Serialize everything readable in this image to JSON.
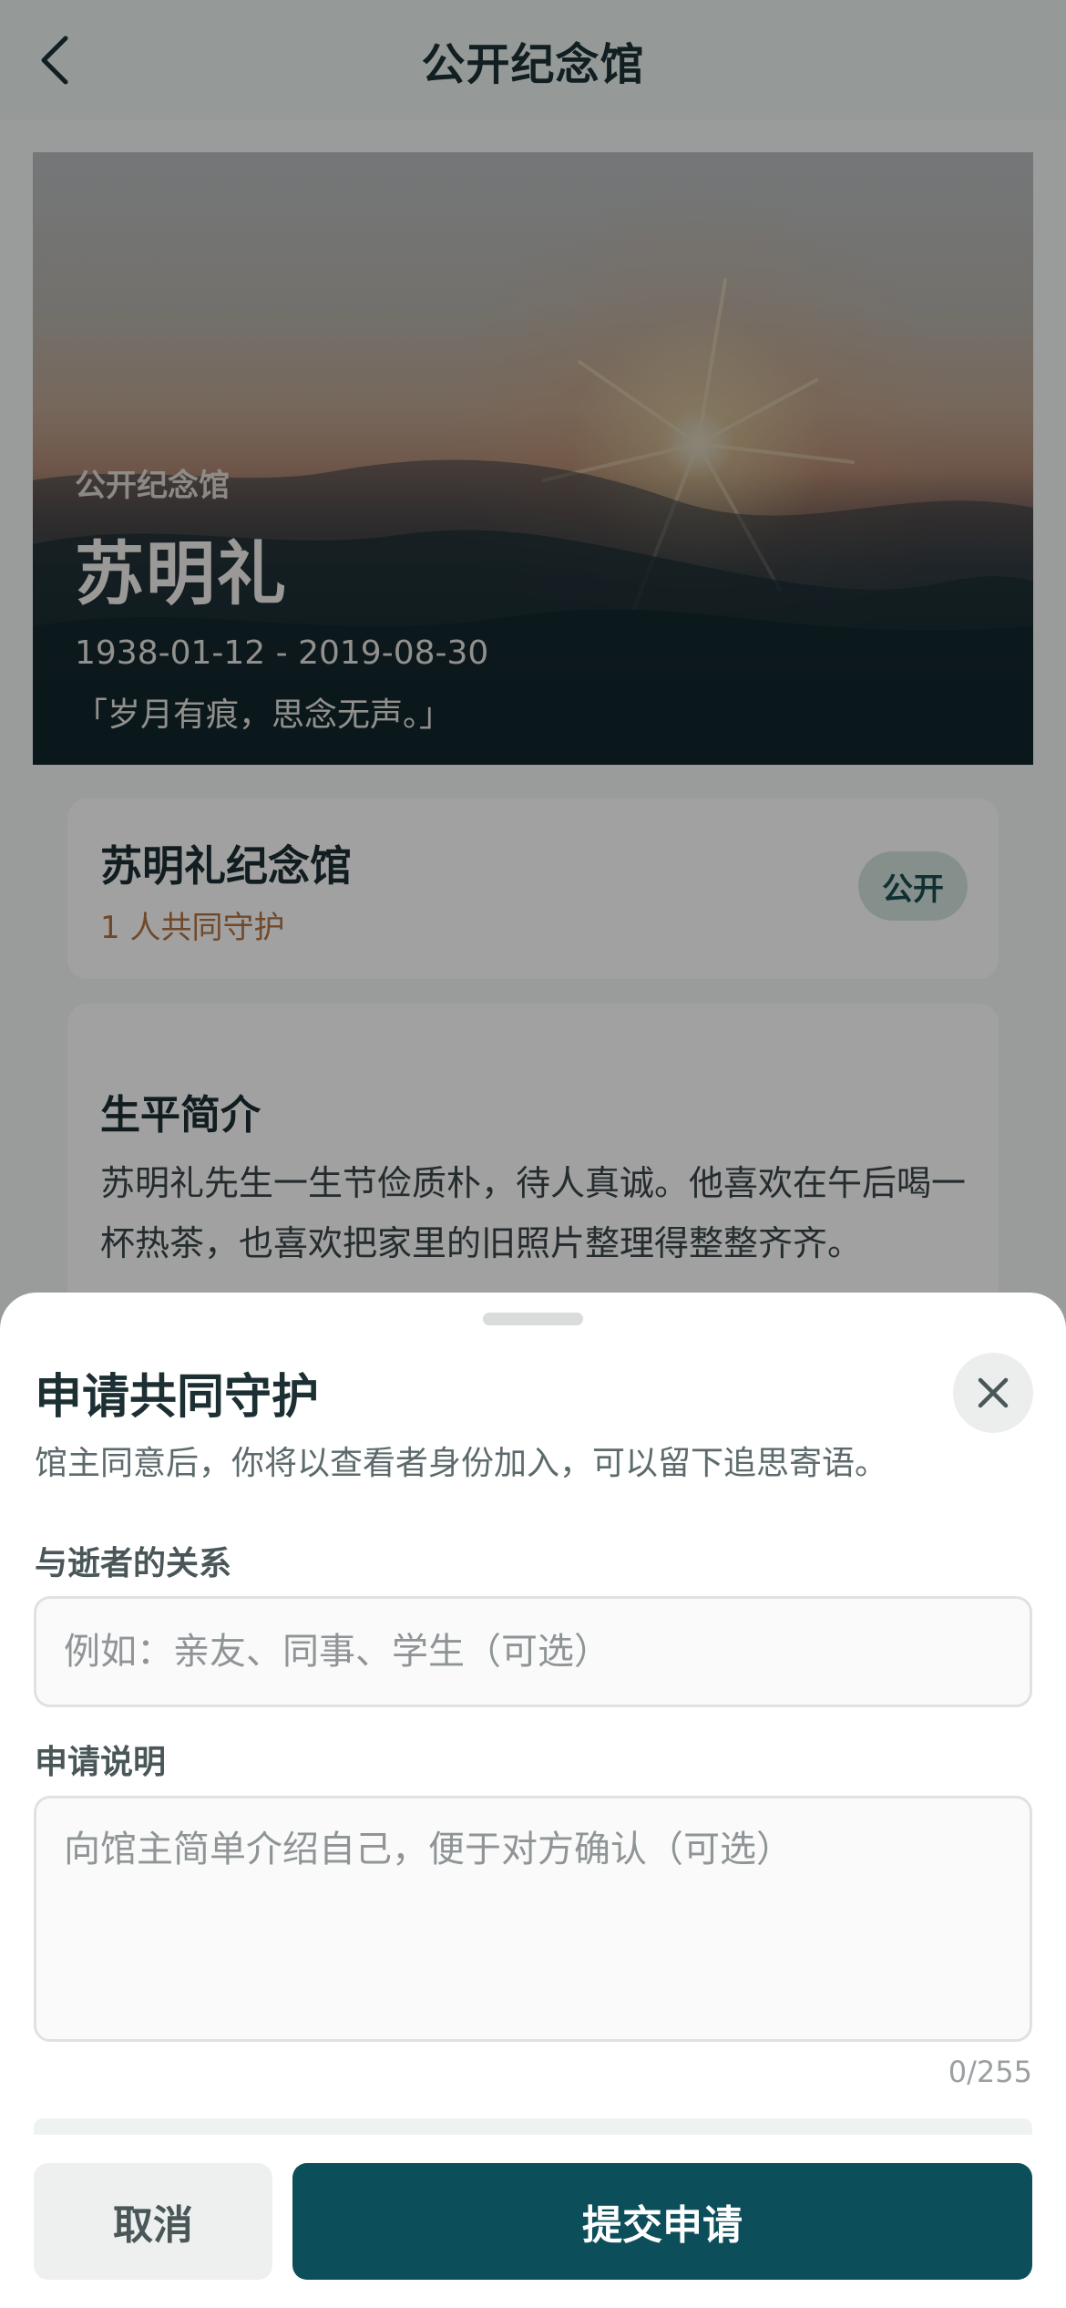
{
  "nav": {
    "title": "公开纪念馆",
    "back_icon": "chevron-left-icon"
  },
  "hero": {
    "label": "公开纪念馆",
    "name": "苏明礼",
    "dates": "1938-01-12 - 2019-08-30",
    "quote": "「岁月有痕，思念无声。」"
  },
  "memorial_card": {
    "title": "苏明礼纪念馆",
    "guardians": "1 人共同守护",
    "badge": "公开"
  },
  "bio": {
    "title": "生平简介",
    "text": "苏明礼先生一生节俭质朴，待人真诚。他喜欢在午后喝一杯热茶，也喜欢把家里的旧照片整理得整整齐齐。"
  },
  "sheet": {
    "title": "申请共同守护",
    "description": "馆主同意后，你将以查看者身份加入，可以留下追思寄语。",
    "relation_label": "与逝者的关系",
    "relation_placeholder": "例如：亲友、同事、学生（可选）",
    "note_label": "申请说明",
    "note_placeholder": "向馆主简单介绍自己，便于对方确认（可选）",
    "counter": "0/255",
    "cancel_label": "取消",
    "submit_label": "提交申请",
    "close_icon": "close-icon"
  },
  "colors": {
    "primary": "#0c4f5b",
    "accent_orange": "#b27443",
    "badge_bg": "#d3e4df",
    "nav_bg": "#ecf3f0"
  }
}
